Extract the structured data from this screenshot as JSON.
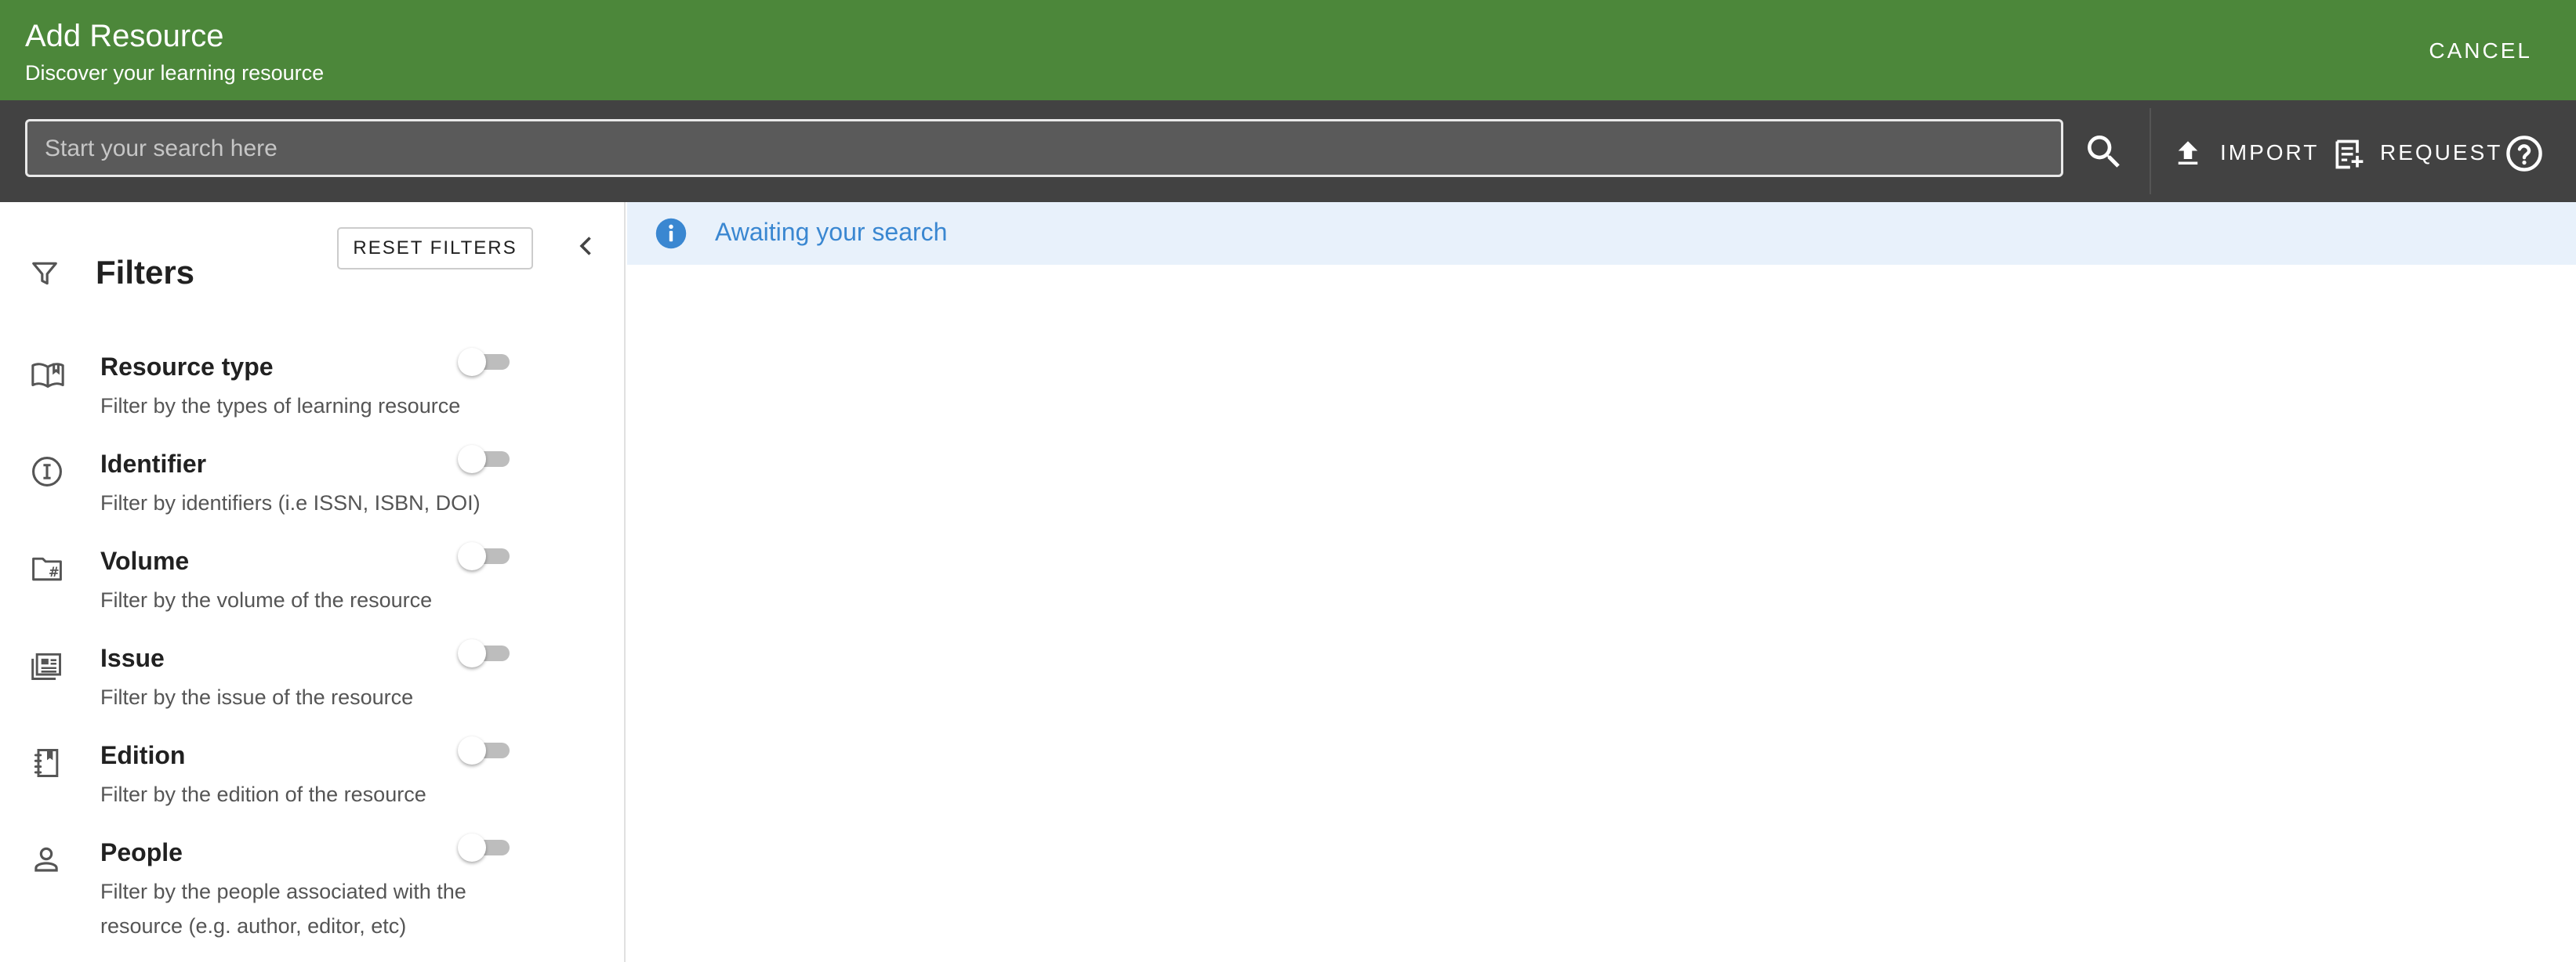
{
  "header": {
    "title": "Add Resource",
    "subtitle": "Discover your learning resource",
    "cancel_label": "CANCEL"
  },
  "toolbar": {
    "search_placeholder": "Start your search here",
    "search_value": "",
    "import_label": "IMPORT",
    "request_label": "REQUEST"
  },
  "sidebar": {
    "title": "Filters",
    "reset_label": "RESET FILTERS",
    "filters": [
      {
        "name": "Resource type",
        "description": "Filter by the types of learning resource",
        "enabled": false,
        "icon": "book-open-icon"
      },
      {
        "name": "Identifier",
        "description": "Filter by identifiers (i.e ISSN, ISBN, DOI)",
        "enabled": false,
        "icon": "identifier-icon"
      },
      {
        "name": "Volume",
        "description": "Filter by the volume of the resource",
        "enabled": false,
        "icon": "folder-hash-icon"
      },
      {
        "name": "Issue",
        "description": "Filter by the issue of the resource",
        "enabled": false,
        "icon": "newspaper-icon"
      },
      {
        "name": "Edition",
        "description": "Filter by the edition of the resource",
        "enabled": false,
        "icon": "notebook-icon"
      },
      {
        "name": "People",
        "description": "Filter by the people associated with the resource (e.g. author, editor, etc)",
        "enabled": false,
        "icon": "person-icon"
      }
    ]
  },
  "main": {
    "status_message": "Awaiting your search"
  },
  "colors": {
    "header": "#4c873a",
    "toolbar": "#424242",
    "info_background": "#e8f1fb",
    "info_accent": "#3a87d1"
  }
}
